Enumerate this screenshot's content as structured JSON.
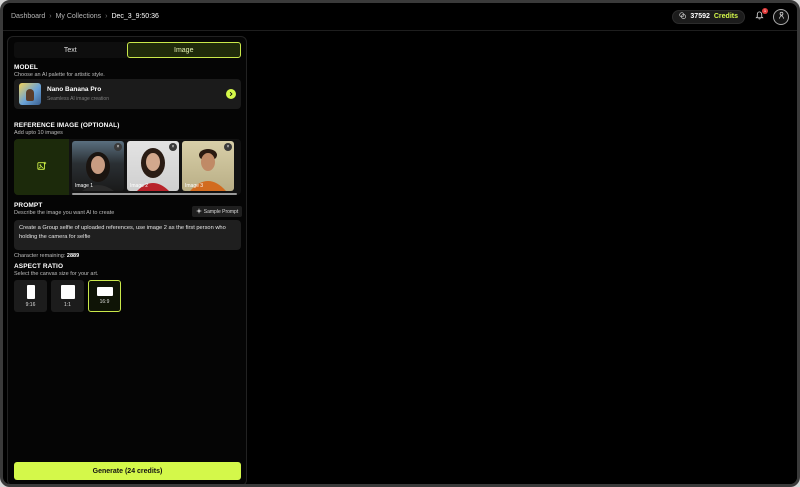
{
  "breadcrumb": {
    "items": [
      "Dashboard",
      "My Collections",
      "Dec_3_9:50:36"
    ]
  },
  "header": {
    "credits_value": "37592",
    "credits_label": "Credits",
    "notification_count": "1"
  },
  "tabs": [
    {
      "label": "Text",
      "active": false
    },
    {
      "label": "Image",
      "active": true
    }
  ],
  "model": {
    "title": "MODEL",
    "subtitle": "Choose an AI palette for artistic style.",
    "name": "Nano Banana Pro",
    "description": "Seamless AI image creation"
  },
  "reference": {
    "title": "REFERENCE IMAGE (OPTIONAL)",
    "subtitle": "Add upto 10 images",
    "images": [
      {
        "label": "Image 1"
      },
      {
        "label": "Image 2"
      },
      {
        "label": "Image 3"
      }
    ]
  },
  "prompt": {
    "title": "PROMPT",
    "subtitle": "Describe the image you want AI to create",
    "sample_label": "Sample Prompt",
    "text": "Create a Group selfie of uploaded references, use image 2 as the first person who holding the camera for selfie",
    "char_label": "Character remaining:",
    "char_value": "2889"
  },
  "aspect": {
    "title": "ASPECT RATIO",
    "subtitle": "Select the canvas size for your art.",
    "options": [
      {
        "label": "9:16"
      },
      {
        "label": "1:1"
      },
      {
        "label": "16:9"
      }
    ],
    "selected": "16:9"
  },
  "generate": {
    "label": "Generate (24 credits)"
  },
  "colors": {
    "accent": "#d4f84a",
    "background": "#000000",
    "card": "#1b1b1b"
  }
}
